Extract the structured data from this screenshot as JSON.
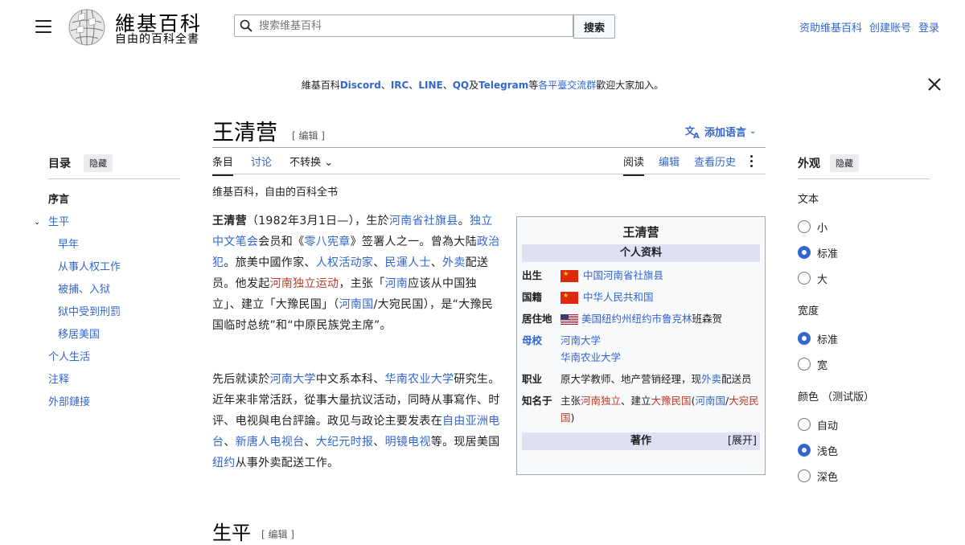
{
  "header": {
    "logo_title": "維基百科",
    "logo_subtitle": "自由的百科全書",
    "search_placeholder": "搜索维基百科",
    "search_button": "搜索",
    "user_links": [
      "资助维基百科",
      "创建账号",
      "登录"
    ]
  },
  "banner": {
    "prefix": "維基百科",
    "discord": "Discord",
    "sep1": "、",
    "irc": "IRC",
    "sep2": "、",
    "line": "LINE",
    "sep3": "、",
    "qq": "QQ",
    "and": "及",
    "telegram": "Telegram",
    "middle": "等",
    "channels": "各平臺交流群",
    "suffix": "歡迎大家加入。"
  },
  "article": {
    "title": "王清营",
    "edit_label": "[ 编辑 ]",
    "add_languages": "添加语言",
    "tabs_left": [
      "条目",
      "讨论",
      "不转换"
    ],
    "tabs_right": [
      "阅读",
      "编辑",
      "查看历史"
    ],
    "tagline": "维基百科，自由的百科全书",
    "section_heading": "生平",
    "section_edit": "[ 编辑 ]"
  },
  "p1": {
    "t0": "王清营",
    "t1": "（1982年3月1日—），生於",
    "l1": "河南省社旗县",
    "t2": "。",
    "l2": "独立中文笔会",
    "t3": "会员和《",
    "l3": "零八宪章",
    "t4": "》签署人之一。曾為大陆",
    "l4": "政治犯",
    "t5": "。旅美中國作家、",
    "l5": "人权活动家",
    "t6": "、",
    "l6": "民運人士",
    "t7": "、",
    "l7": "外卖",
    "t8": "配送员。他发起",
    "r1": "河南独立运动",
    "t9": "，主张「",
    "l8": "河南",
    "t10": "应该从中国独立」、建立「大豫民国」（",
    "l9": "河南国",
    "t11": "/大宛民国），是“大豫民国临时总统”和“中原民族党主席”。"
  },
  "p2": {
    "t0": "先后就读於",
    "l1": "河南大学",
    "t1": "中文系本科、",
    "l2": "华南农业大学",
    "t2": "研究生。近年来非常活跃，從事大量抗议活动，同時从事寫作、时评、电视與电台評論。政见与政论主要发表在",
    "l3": "自由亚洲电台",
    "t3": "、",
    "l4": "新唐人电视台",
    "t4": "、",
    "l5": "大纪元时报",
    "t5": "、",
    "l6": "明镜电视",
    "t6": "等。现居美国",
    "l7": "纽约",
    "t7": "从事外卖配送工作。"
  },
  "infobox": {
    "title": "王清营",
    "personal_header": "个人资料",
    "birth_label": "出生",
    "birth_value": "中国河南省社旗县",
    "nationality_label": "国籍",
    "nationality_value": "中华人民共和国",
    "residence_label": "居住地",
    "residence_link": "美国纽约州纽约市鲁克林",
    "residence_text": "班森贺",
    "alma_label": "母校",
    "alma_values": [
      "河南大学",
      "华南农业大学"
    ],
    "job_label": "职业",
    "job_text1": "原大学教师、地产营销经理，现",
    "job_link": "外卖",
    "job_text2": "配送员",
    "known_label": "知名于",
    "known_t1": "主张",
    "known_r1": "河南独立",
    "known_t2": "、建立",
    "known_r2": "大豫民国",
    "known_t3": "(",
    "known_l1": "河南国",
    "known_t4": "/",
    "known_r3": "大宛民国",
    "known_t5": ")",
    "works_header": "著作",
    "expand": "[展开]"
  },
  "toc": {
    "title": "目录",
    "hide": "隐藏",
    "items": [
      "序言",
      "生平",
      "早年",
      "从事人权工作",
      "被捕、入狱",
      "狱中受到刑罰",
      "移居美国",
      "个人生活",
      "注释",
      "外部鏈接"
    ]
  },
  "appearance": {
    "title": "外观",
    "hide": "隐藏",
    "text_label": "文本",
    "text_options": [
      "小",
      "标准",
      "大"
    ],
    "width_label": "宽度",
    "width_options": [
      "标准",
      "宽"
    ],
    "color_label": "颜色 （测试版）",
    "color_options": [
      "自动",
      "浅色",
      "深色"
    ],
    "selected": {
      "text": "标准",
      "width": "标准",
      "color": "浅色"
    }
  },
  "colors": {
    "link": "#3366cc",
    "redlink": "#ba3d2a",
    "accent": "#3366cc"
  }
}
